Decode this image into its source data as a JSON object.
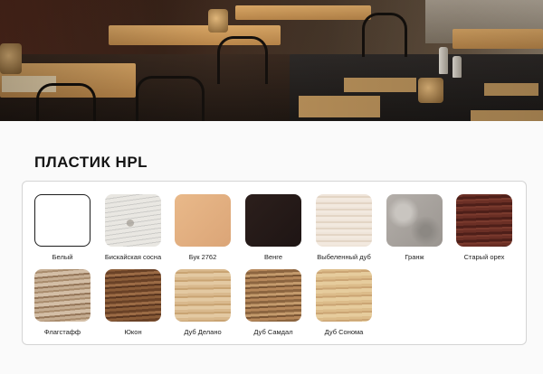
{
  "section": {
    "title": "ПЛАСТИК HPL"
  },
  "swatches": [
    {
      "label": "Белый",
      "texture": "white"
    },
    {
      "label": "Бискайская сосна",
      "texture": "biscay-pine"
    },
    {
      "label": "Бук 2762",
      "texture": "beech"
    },
    {
      "label": "Венге",
      "texture": "wenge"
    },
    {
      "label": "Выбеленный дуб",
      "texture": "bleached-oak"
    },
    {
      "label": "Гранж",
      "texture": "grange"
    },
    {
      "label": "Старый орех",
      "texture": "old-walnut"
    },
    {
      "label": "Флагстафф",
      "texture": "flagstaff"
    },
    {
      "label": "Юкон",
      "texture": "yukon"
    },
    {
      "label": "Дуб Делано",
      "texture": "oak-delano"
    },
    {
      "label": "Дуб Самдал",
      "texture": "oak-samdal"
    },
    {
      "label": "Дуб Сонома",
      "texture": "oak-sonoma"
    }
  ]
}
